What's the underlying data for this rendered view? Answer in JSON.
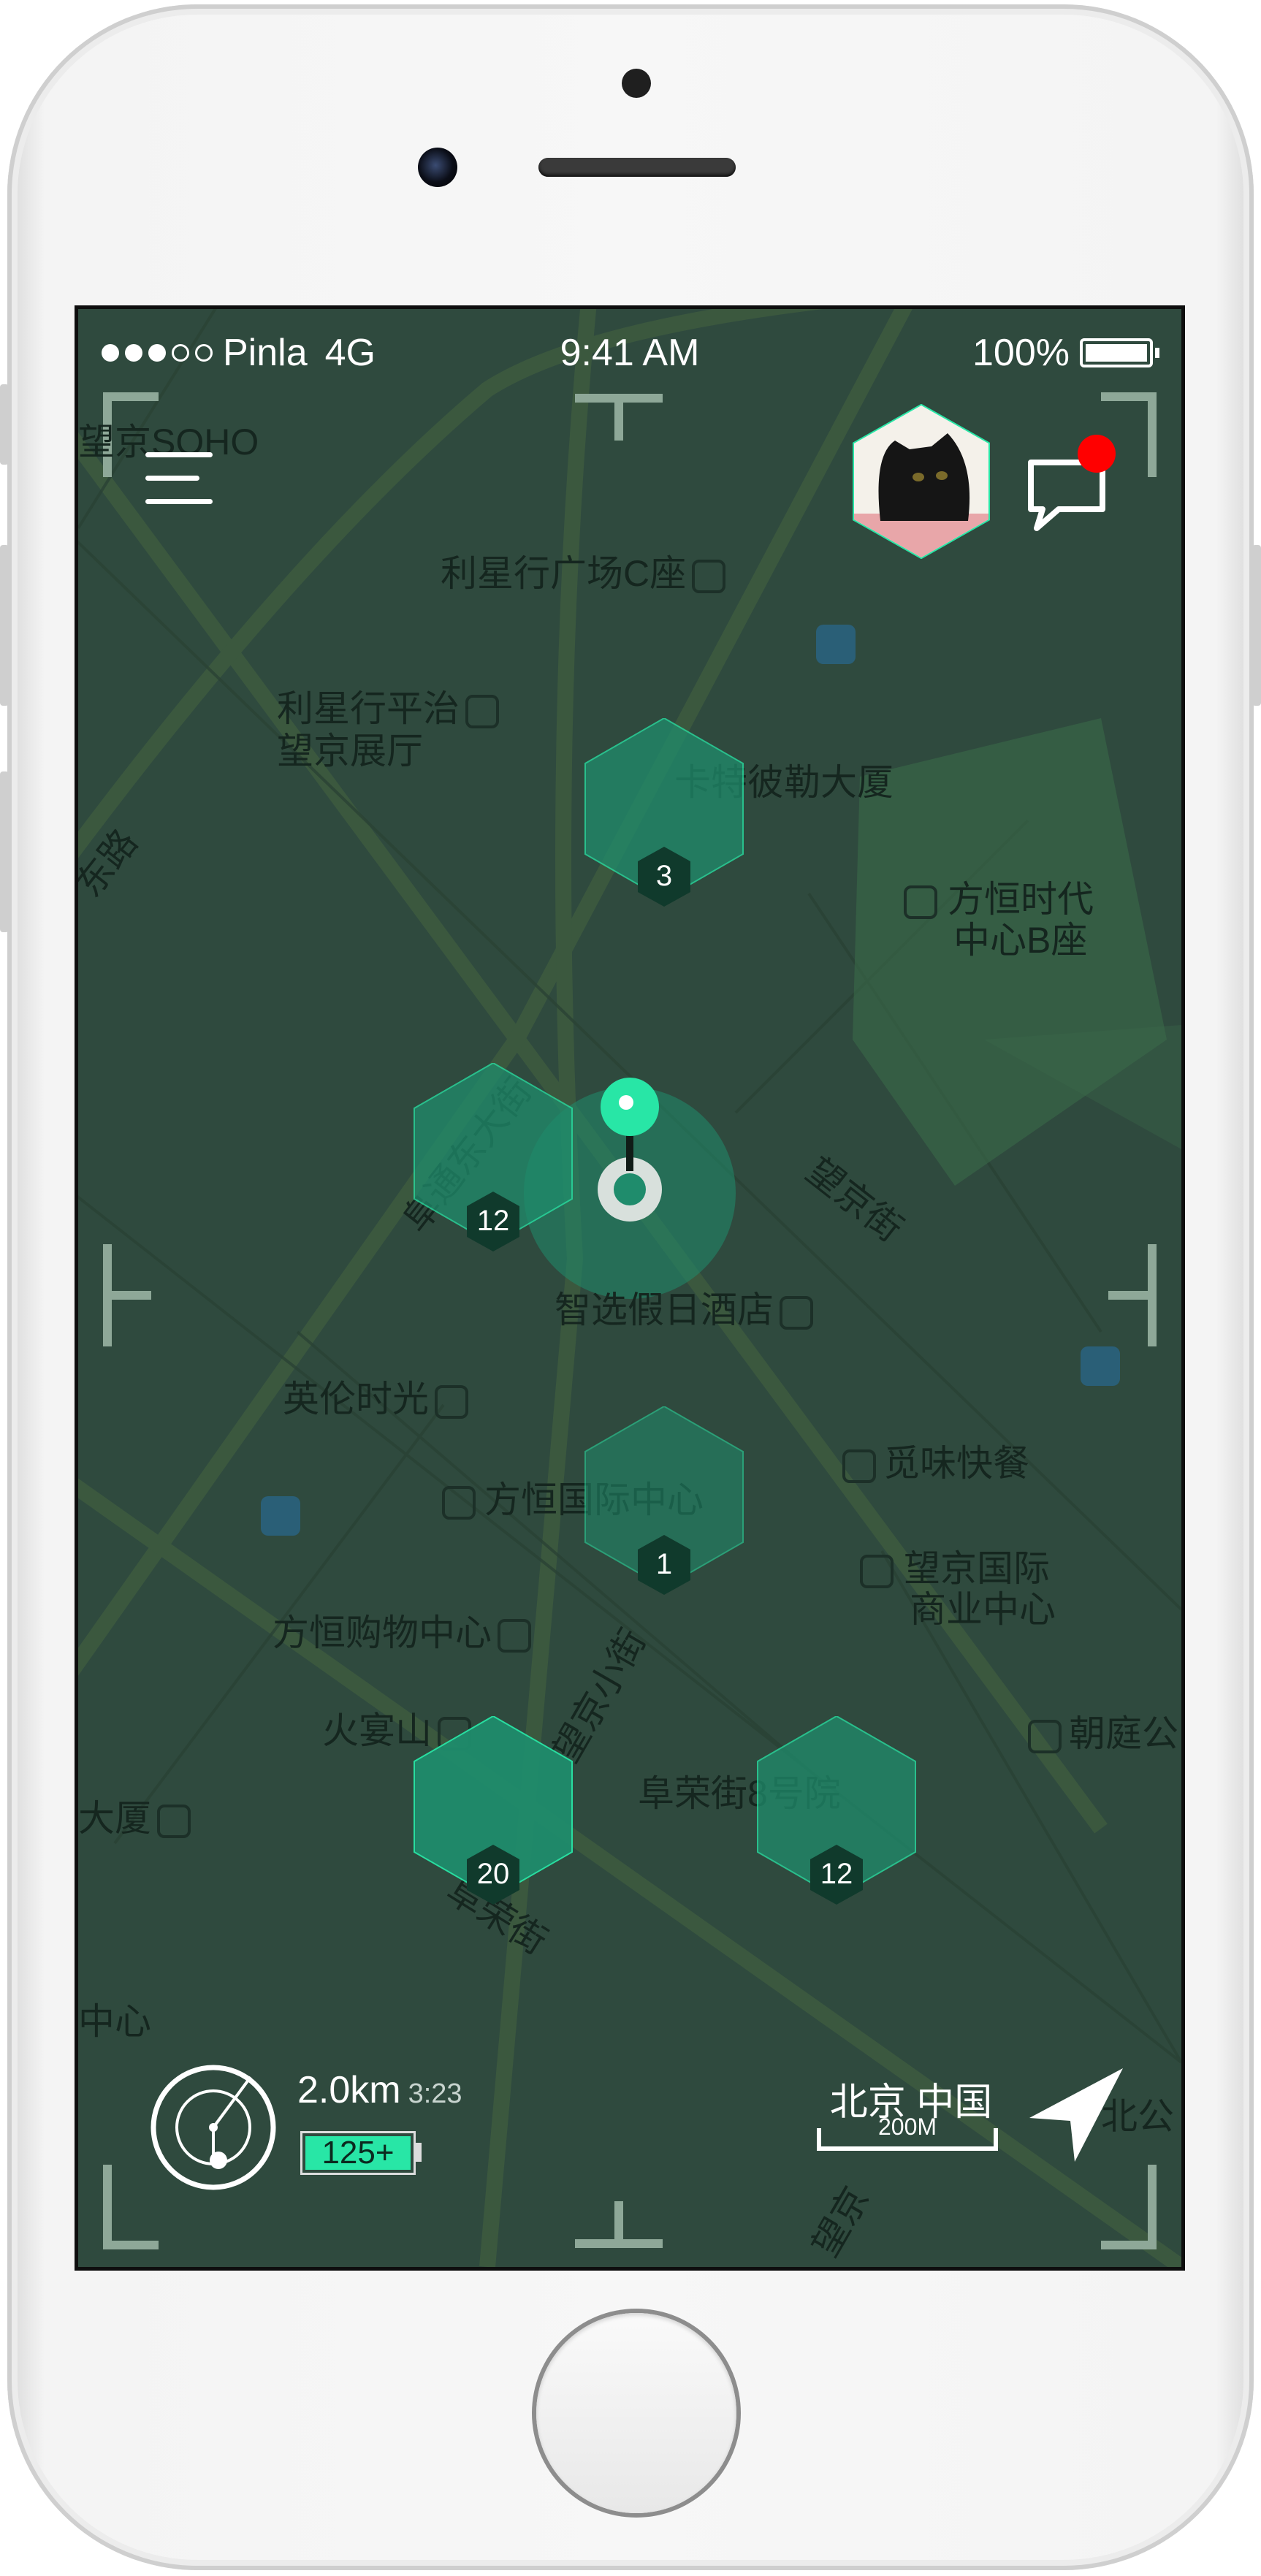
{
  "status_bar": {
    "carrier": "Pinla",
    "network": "4G",
    "time": "9:41 AM",
    "battery": "100%",
    "signal_bars": 3,
    "signal_total": 5
  },
  "map": {
    "labels": [
      "望京SOHO",
      "利星行广场C座",
      "利星行平治",
      "望京展厅",
      "卡特彼勒大厦",
      "方恒时代",
      "中心B座",
      "东路",
      "望京街",
      "阜通东大街",
      "智选假日酒店",
      "英伦时光",
      "觅味快餐",
      "方恒国际中心",
      "望京国际",
      "商业中心",
      "方恒购物中心",
      "火宴山",
      "望京小街",
      "朝庭公",
      "阜荣街8号院",
      "大厦",
      "阜荣街",
      "中心",
      "北公",
      "望京"
    ]
  },
  "hexagons": [
    {
      "count": "3"
    },
    {
      "count": "12"
    },
    {
      "count": "1"
    },
    {
      "count": "20"
    },
    {
      "count": "12"
    }
  ],
  "bottom": {
    "distance": "2.0km",
    "duration": "3:23",
    "energy": "125+",
    "location": "北京 中国",
    "scale": "200M"
  },
  "colors": {
    "map_bg": "#2f4a3e",
    "accent": "#28e6a6",
    "hex_fill": "#1f8c6c",
    "notification": "#ff0000"
  },
  "icons": [
    "menu-icon",
    "avatar",
    "chat-icon",
    "radar-icon",
    "navigation-arrow-icon",
    "location-pin-icon"
  ]
}
